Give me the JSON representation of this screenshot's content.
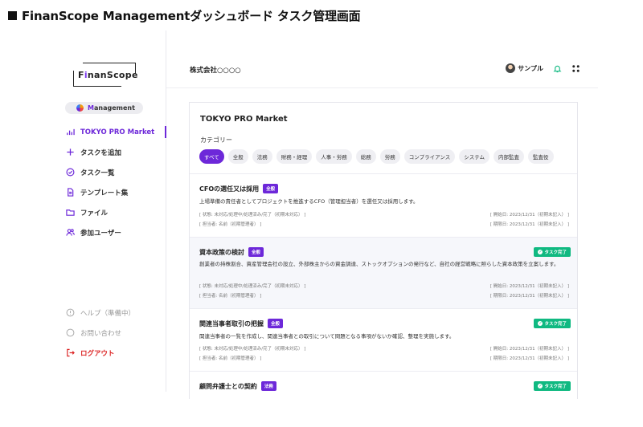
{
  "caption": "FinanScope Managementダッシュボード タスク管理画面",
  "logo": {
    "text_before": "F",
    "text_i": "i",
    "text_after": "nanScope"
  },
  "mgmt_pill": {
    "highlight": "M",
    "rest": "anagement"
  },
  "nav": [
    {
      "label": "TOKYO PRO Market",
      "icon": "bar-chart-icon",
      "active": true
    },
    {
      "label": "タスクを追加",
      "icon": "plus-icon"
    },
    {
      "label": "タスク一覧",
      "icon": "check-circle-icon"
    },
    {
      "label": "テンプレート集",
      "icon": "document-icon"
    },
    {
      "label": "ファイル",
      "icon": "folder-icon"
    },
    {
      "label": "参加ユーザー",
      "icon": "users-icon"
    }
  ],
  "nav_bottom": [
    {
      "label": "ヘルプ（準備中）",
      "icon": "help-icon"
    },
    {
      "label": "お問い合わせ",
      "icon": "chat-icon"
    },
    {
      "label": "ログアウト",
      "icon": "logout-icon"
    }
  ],
  "header": {
    "company": "株式会社○○○○",
    "user": "サンプル"
  },
  "card": {
    "title": "TOKYO PRO Market",
    "category_label": "カテゴリー",
    "chips": [
      "すべて",
      "全般",
      "法務",
      "財務・経理",
      "人事・労務",
      "総務",
      "労務",
      "コンプライアンス",
      "システム",
      "内部監査",
      "監査役"
    ],
    "tasks": [
      {
        "title": "CFOの選任又は採用",
        "badge": "全般",
        "done": "",
        "desc": "上場準備の責任者としてプロジェクトを推進するCFO（管理担当者）を選任又は採用します。",
        "status": "[ 状態: 未対応/処理中/処理済み/完了（初期未対応） ]",
        "owner": "[ 担当者: 名前（初期管理者） ]",
        "start": "[ 開始日: 2023/12/31（初期未記入） ]",
        "due": "[ 期限日: 2023/12/31（初期未記入） ]"
      },
      {
        "title": "資本政策の検討",
        "badge": "全般",
        "done": "タスク完了",
        "desc": "創業者の持株割合、資産管理会社の設立、外部株主からの資金調達、ストックオプションの発行など、自社の経営戦略に照らした資本政策を立案します。",
        "status": "[ 状態: 未対応/処理中/処理済み/完了（初期未対応） ]",
        "owner": "[ 担当者: 名前（初期管理者） ]",
        "start": "[ 開始日: 2023/12/31（初期未記入） ]",
        "due": "[ 期限日: 2023/12/31（初期未記入） ]"
      },
      {
        "title": "関連当事者取引の把握",
        "badge": "全般",
        "done": "タスク完了",
        "desc": "関連当事者の一覧を作成し、関連当事者との取引について問題となる事項がないか確認、整理を実施します。",
        "status": "[ 状態: 未対応/処理中/処理済み/完了（初期未対応） ]",
        "owner": "[ 担当者: 名前（初期管理者） ]",
        "start": "[ 開始日: 2023/12/31（初期未記入） ]",
        "due": "[ 期限日: 2023/12/31（初期未記入） ]"
      },
      {
        "title": "顧問弁護士との契約",
        "badge": "法務",
        "done": "タスク完了"
      }
    ]
  }
}
